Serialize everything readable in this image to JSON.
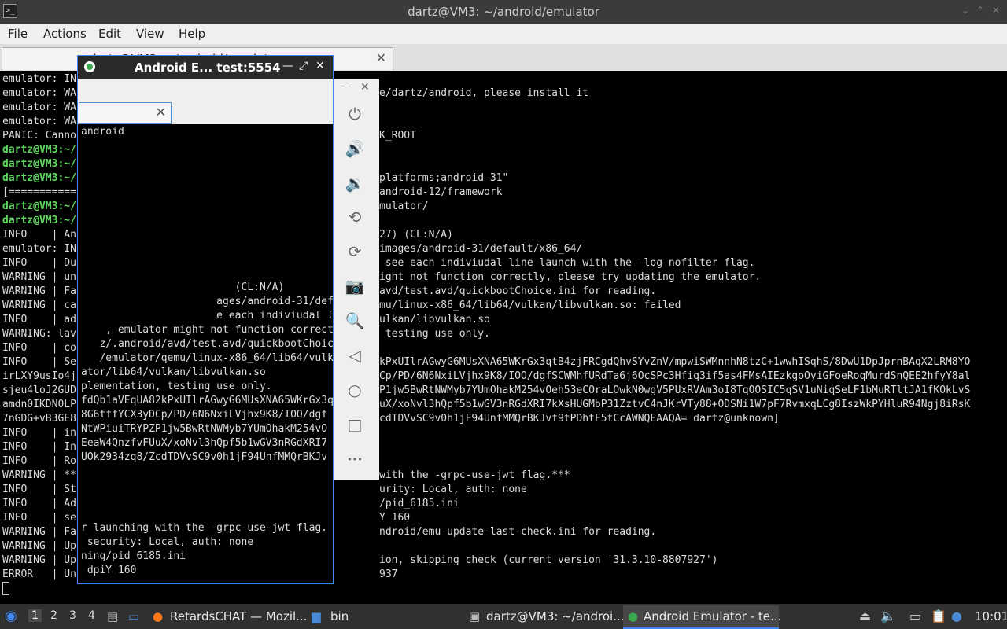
{
  "window": {
    "title": "dartz@VM3: ~/android/emulator"
  },
  "menu": [
    "File",
    "Actions",
    "Edit",
    "View",
    "Help"
  ],
  "terminal_tab": {
    "label": "dartz@VM3: ~/android/emulator"
  },
  "terminal": {
    "lines": [
      {
        "t": "emulator: IN"
      },
      {
        "t": "emulator: WA"
      },
      {
        "t": "emulator: WA"
      },
      {
        "t": "emulator: WA"
      },
      {
        "t": "PANIC: Canno"
      },
      {
        "p": "dartz@VM3:~/",
        "t": ""
      },
      {
        "p": "dartz@VM3:~/",
        "t": ""
      },
      {
        "p": "dartz@VM3:~/",
        "t": ""
      },
      {
        "t": "[==========="
      },
      {
        "p": "dartz@VM3:~/",
        "t": ""
      },
      {
        "p": "dartz@VM3:~/",
        "t": ""
      },
      {
        "t": "INFO    | An"
      },
      {
        "t": "emulator: IN"
      },
      {
        "t": "INFO    | Du"
      },
      {
        "t": "WARNING | un"
      },
      {
        "t": "WARNING | Fa"
      },
      {
        "t": "WARNING | ca"
      },
      {
        "t": "INFO    | ad"
      },
      {
        "t": "WARNING: lav"
      },
      {
        "t": "INFO    | co"
      },
      {
        "t": "INFO    | Se"
      },
      {
        "t": "irLXY9usIo4j"
      },
      {
        "t": "sjeu4loJ2GUD"
      },
      {
        "t": "amdn0IKDN0LP"
      },
      {
        "t": "7nGDG+vB3GE8"
      },
      {
        "t": "INFO    | in"
      },
      {
        "t": "INFO    | In"
      },
      {
        "t": "INFO    | Ro"
      },
      {
        "t": "WARNING | **"
      },
      {
        "t": "INFO    | St"
      },
      {
        "t": "INFO    | Ad"
      },
      {
        "t": "INFO    | se"
      },
      {
        "t": "WARNING | Fa"
      },
      {
        "t": "WARNING | Up"
      },
      {
        "t": "WARNING | Up"
      },
      {
        "t": "ERROR   | Un"
      }
    ],
    "right_lines": [
      {
        "row": 1,
        "t": "e/dartz/android, please install it"
      },
      {
        "row": 4,
        "t": "K_ROOT"
      },
      {
        "row": 7,
        "t": "platforms;android-31\""
      },
      {
        "row": 8,
        "t": "android-12/framework"
      },
      {
        "row": 9,
        "t": "mulator/"
      },
      {
        "row": 11,
        "t": "27) (CL:N/A)"
      },
      {
        "row": 12,
        "t": "images/android-31/default/x86_64/"
      },
      {
        "row": 13,
        "t": " see each indiviudal line launch with the -log-nofilter flag."
      },
      {
        "row": 14,
        "t": "ight not function correctly, please try updating the emulator."
      },
      {
        "row": 15,
        "t": "avd/test.avd/quickbootChoice.ini for reading."
      },
      {
        "row": 16,
        "t": "mu/linux-x86_64/lib64/vulkan/libvulkan.so: failed"
      },
      {
        "row": 17,
        "t": "ulkan/libvulkan.so"
      },
      {
        "row": 18,
        "t": " testing use only."
      },
      {
        "row": 20,
        "t": "kPxUIlrAGwyG6MUsXNA65WKrGx3qtB4zjFRCgdQhvSYvZnV/mpwiSWMnnhN8tzC+1wwhISqhS/8DwU1DpJprnBAqX2LRM8YO"
      },
      {
        "row": 21,
        "t": "Cp/PD/6N6NxiLVjhx9K8/IOO/dgfSCWMhfURdTa6j6OcSPc3Hfiq3if5as4FMsAIEzkgoOyiGFoeRoqMurdSnQEE2hfyY8al"
      },
      {
        "row": 22,
        "t": "P1jw5BwRtNWMyb7YUmOhakM254vOeh53eCOraLOwkN0wgV5PUxRVAm3oI8TqOOSIC5qSV1uNiqSeLF1bMuRTltJA1fKOkLvS"
      },
      {
        "row": 23,
        "t": "uX/xoNvl3hQpf5b1wGV3nRGdXRI7kXsHUGMbP31ZztvC4nJKrVTy88+ODSNi1W7pF7RvmxqLCg8IszWkPYHluR94Ngj8iRsK"
      },
      {
        "row": 24,
        "t": "cdTDVvSC9v0h1jF94UnfMMQrBKJvf9tPDhtF5tCcAWNQEAAQA= dartz@unknown]"
      },
      {
        "row": 28,
        "t": "with the -grpc-use-jwt flag.***"
      },
      {
        "row": 29,
        "t": "urity: Local, auth: none"
      },
      {
        "row": 30,
        "t": "/pid_6185.ini"
      },
      {
        "row": 31,
        "t": "Y 160"
      },
      {
        "row": 32,
        "t": "ndroid/emu-update-last-check.ini for reading."
      },
      {
        "row": 34,
        "t": "ion, skipping check (current version '31.3.10-8807927')"
      },
      {
        "row": 35,
        "t": "937"
      }
    ]
  },
  "emulator_window": {
    "title": "Android E... test:5554",
    "screen_lines": [
      {
        "row": 0,
        "t": "android"
      },
      {
        "row": 11,
        "t": "                         (CL:N/A)"
      },
      {
        "row": 12,
        "t": "                      ages/android-31/default/x8"
      },
      {
        "row": 13,
        "t": "                      e each indiviudal line la"
      },
      {
        "row": 14,
        "t": "    , emulator might not function correctly,"
      },
      {
        "row": 15,
        "t": "   z/.android/avd/test.avd/quickbootChoice."
      },
      {
        "row": 16,
        "t": "   /emulator/qemu/linux-x86_64/lib64/vulkan"
      },
      {
        "row": 17,
        "t": "ator/lib64/vulkan/libvulkan.so"
      },
      {
        "row": 18,
        "t": "plementation, testing use only."
      },
      {
        "row": 19,
        "t": "fdQb1aVEqUA82kPxUIlrAGwyG6MUsXNA65WKrGx3q"
      },
      {
        "row": 20,
        "t": "8G6tffYCX3yDCp/PD/6N6NxiLVjhx9K8/IOO/dgf"
      },
      {
        "row": 21,
        "t": "NtWPiuiTRYPZP1jw5BwRtNWMyb7YUmOhakM254vO"
      },
      {
        "row": 22,
        "t": "EeaW4QnzfvFUuX/xoNvl3hQpf5b1wGV3nRGdXRI7"
      },
      {
        "row": 23,
        "t": "UOk2934zq8/ZcdTDVvSC9v0h1jF94UnfMMQrBKJv"
      },
      {
        "row": 28,
        "t": "r launching with the -grpc-use-jwt flag."
      },
      {
        "row": 29,
        "t": " security: Local, auth: none"
      },
      {
        "row": 30,
        "t": "ning/pid_6185.ini"
      },
      {
        "row": 31,
        "t": " dpiY 160"
      }
    ]
  },
  "emulator_toolbar": {
    "buttons": [
      {
        "icon": "power-icon",
        "glyph": "⏻"
      },
      {
        "icon": "volume-up-icon",
        "glyph": "🔊"
      },
      {
        "icon": "volume-down-icon",
        "glyph": "🔉"
      },
      {
        "icon": "rotate-left-icon",
        "glyph": "⟲"
      },
      {
        "icon": "rotate-right-icon",
        "glyph": "⟳"
      },
      {
        "icon": "camera-icon",
        "glyph": "📷"
      },
      {
        "icon": "zoom-icon",
        "glyph": "🔍"
      },
      {
        "icon": "back-icon",
        "glyph": "◁"
      },
      {
        "icon": "home-icon",
        "glyph": "○"
      },
      {
        "icon": "overview-icon",
        "glyph": "□"
      },
      {
        "icon": "more-icon",
        "glyph": "•••"
      }
    ]
  },
  "taskbar": {
    "workspaces": [
      "1",
      "2",
      "3",
      "4"
    ],
    "tasks": [
      {
        "label": "RetardsCHAT — Mozil..."
      },
      {
        "label": "bin"
      },
      {
        "label": "dartz@VM3: ~/androi..."
      },
      {
        "label": "Android Emulator - te..."
      }
    ],
    "clock": "10:01"
  }
}
